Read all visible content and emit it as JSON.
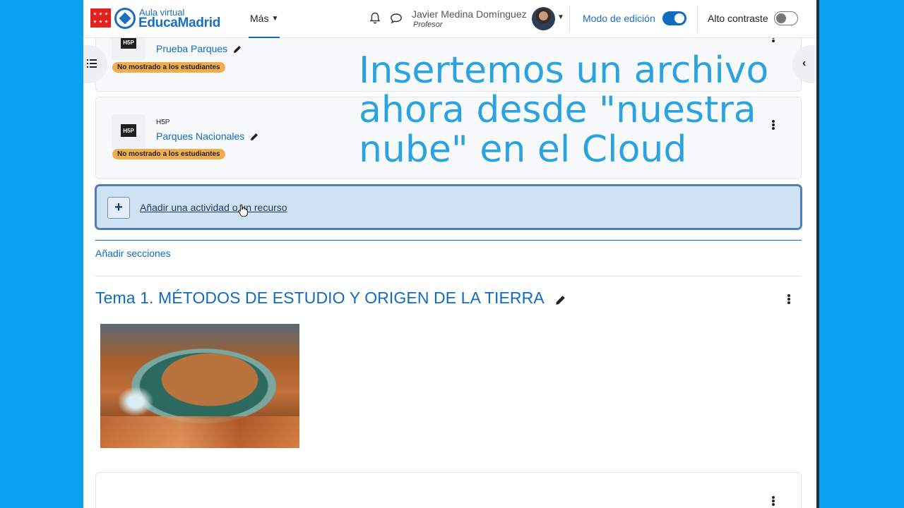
{
  "header": {
    "logo_top": "Aula virtual",
    "logo_main": "EducaMadrid",
    "nav_more": "Más",
    "user_name": "Javier Medina Domínguez",
    "user_role": "Profesor",
    "edit_mode_label": "Modo de edición",
    "edit_mode_on": true,
    "contrast_label": "Alto contraste",
    "contrast_on": false
  },
  "activities": [
    {
      "type": "H5P",
      "name": "Prueba Parques",
      "badge": "No mostrado a los estudiantes"
    },
    {
      "type": "H5P",
      "name": "Parques Nacionales",
      "badge": "No mostrado a los estudiantes"
    }
  ],
  "h5p_logo_text": "H5P",
  "add_activity": {
    "plus": "+",
    "label": "Añadir una actividad o un recurso"
  },
  "add_sections": "Añadir secciones",
  "section": {
    "title": "Tema 1. MÉTODOS DE ESTUDIO Y ORIGEN DE LA TIERRA"
  },
  "overlay": {
    "line1": "Insertemos un archivo",
    "line2": "ahora desde \"nuestra",
    "line3": "nube\" en el Cloud"
  },
  "colors": {
    "accent": "#0f6cbf",
    "badge": "#f0ad4e",
    "overlay_text": "#2aa3e0",
    "background": "#0aa1ef"
  },
  "icons": [
    "bell-icon",
    "chat-icon",
    "pencil-icon",
    "kebab-menu-icon",
    "chevron-left-icon",
    "course-index-icon",
    "cursor-hand-icon"
  ]
}
